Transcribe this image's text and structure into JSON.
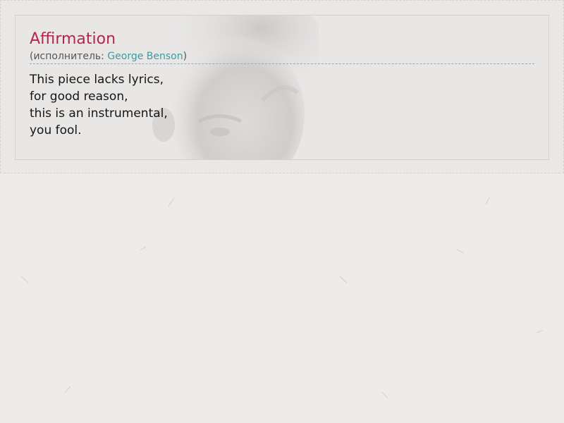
{
  "song": {
    "title": "Affirmation",
    "performer_prefix": "(исполнитель: ",
    "artist": "George Benson",
    "performer_suffix": ")"
  },
  "lyrics": [
    "This piece lacks lyrics,",
    "for good reason,",
    "this is an instrumental,",
    "you fool."
  ],
  "colors": {
    "title": "#b3264f",
    "artist_link": "#3a9ea0",
    "card_background": "#e8e7e6",
    "page_background": "#efebe8"
  }
}
